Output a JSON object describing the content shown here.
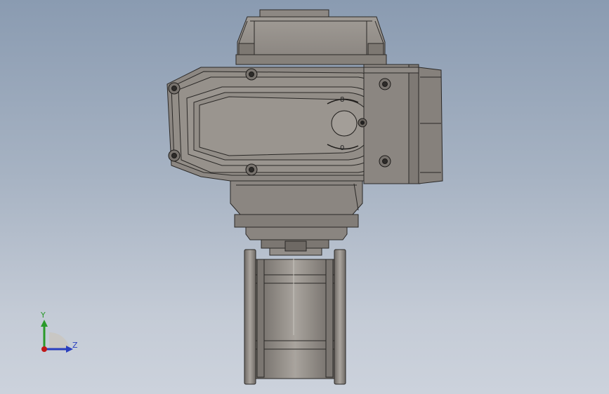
{
  "viewport": {
    "background_top": "#8a9bb1",
    "background_bottom": "#ccd2dc",
    "model_color": "#8f8a84",
    "edge_color": "#2a2826"
  },
  "triad": {
    "y_label": "Y",
    "z_label": "Z",
    "y_color": "#2a9a2a",
    "z_color": "#2a3fbf",
    "x_color": "#c01818"
  },
  "cover_markings": {
    "top_symbol": "8",
    "bottom_symbol": "0"
  }
}
